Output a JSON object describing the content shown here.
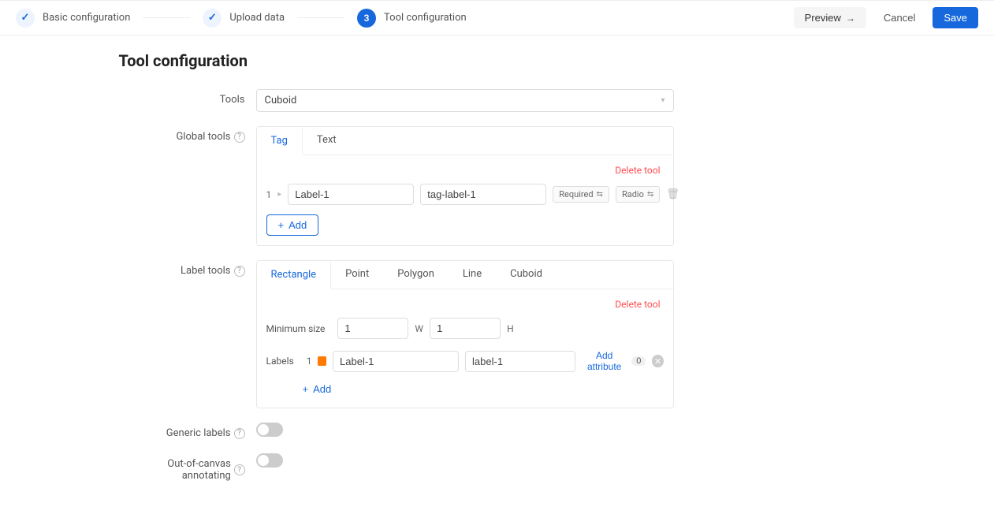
{
  "steps": {
    "basic": "Basic configuration",
    "upload": "Upload data",
    "tool_num": "3",
    "tool": "Tool configuration"
  },
  "actions": {
    "preview": "Preview",
    "cancel": "Cancel",
    "save": "Save"
  },
  "page_title": "Tool configuration",
  "form": {
    "tools_label": "Tools",
    "tools_value": "Cuboid",
    "global_label": "Global tools",
    "label_tools_label": "Label tools",
    "generic_labels": "Generic labels",
    "oocanvas": "Out-of-canvas annotating"
  },
  "global_panel": {
    "tabs": {
      "tag": "Tag",
      "text": "Text"
    },
    "delete": "Delete tool",
    "row": {
      "index": "1",
      "name": "Label-1",
      "key": "tag-label-1",
      "required": "Required",
      "radio": "Radio"
    },
    "add": "Add"
  },
  "label_panel": {
    "tabs": {
      "rect": "Rectangle",
      "point": "Point",
      "polygon": "Polygon",
      "line": "Line",
      "cuboid": "Cuboid"
    },
    "delete": "Delete tool",
    "min": {
      "label": "Minimum size",
      "w": "1",
      "h": "1",
      "wl": "W",
      "hl": "H"
    },
    "labels_label": "Labels",
    "row": {
      "index": "1",
      "name": "Label-1",
      "key": "label-1"
    },
    "add_attr": "Add attribute",
    "attr_count": "0",
    "add": "Add"
  },
  "toggles": {
    "generic": false,
    "oocanvas": false
  }
}
